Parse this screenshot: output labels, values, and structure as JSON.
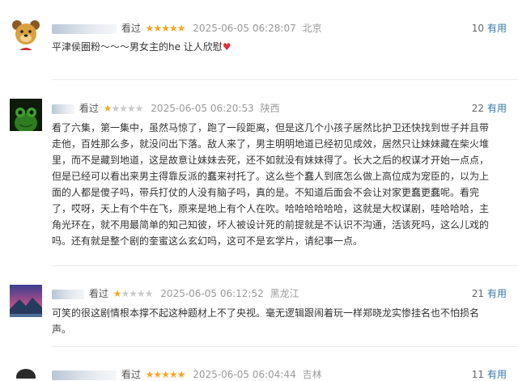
{
  "comments": [
    {
      "action": "看过",
      "stars_text": "★★★★★",
      "stars_off": "",
      "time": "2025-06-05 06:28:07",
      "location": "北京",
      "votes": "10",
      "useful_label": "有用",
      "content": "平津侯圈粉～～～男女主的he 让人欣慰",
      "emoji": "♥"
    },
    {
      "action": "看过",
      "stars_text": "★",
      "stars_off": "★★★★",
      "time": "2025-06-05 06:20:53",
      "location": "陕西",
      "votes": "22",
      "useful_label": "有用",
      "content": "看了六集，第一集中，虽然马惊了，跑了一段距离，但是这几个小孩子居然比护卫还快找到世子并且带走他，百姓那么多，就没问出下落。敌人来了，男主明明地道已经初见成效，居然只让妹妹藏在柴火堆里，而不是藏到地道，这是故意让妹妹去死，还不如就没有妹妹得了。长大之后的权谋才开始一点点，但是已经可以看出来男主得靠反派的蠢来衬托了。这么些个蠢人到底怎么做上高位成为宠臣的，以为上面的人都是傻子吗，带兵打仗的人没有脑子吗，真的是。不知道后面会不会让对家更蠢更蠢呢。看完了，哎呀，天上有个牛在飞，原来是地上有个人在吹。哈哈哈哈哈哈，这就是大权谋剧，哇哈哈哈，主角光环在，就不用最简单的知己知彼，坏人被设计死的前提就是不认识不沟通，活该死吗，这么儿戏的吗。还有就是整个剧的奎蜜这么玄幻吗，这可不是玄学片，请纪事一点。"
    },
    {
      "action": "看过",
      "stars_text": "★",
      "stars_off": "★★★★",
      "time": "2025-06-05 06:12:52",
      "location": "黑龙江",
      "votes": "21",
      "useful_label": "有用",
      "content": "可笑的很这剧情根本撑不起这种题材上不了央视。毫无逻辑跟闹着玩一样郑晓龙实惨挂名也不怕损名声。"
    },
    {
      "action": "看过",
      "stars_text": "★★★★★",
      "stars_off": "",
      "time": "2025-06-05 06:04:44",
      "location": "吉林",
      "votes": "11",
      "useful_label": "有用"
    }
  ]
}
